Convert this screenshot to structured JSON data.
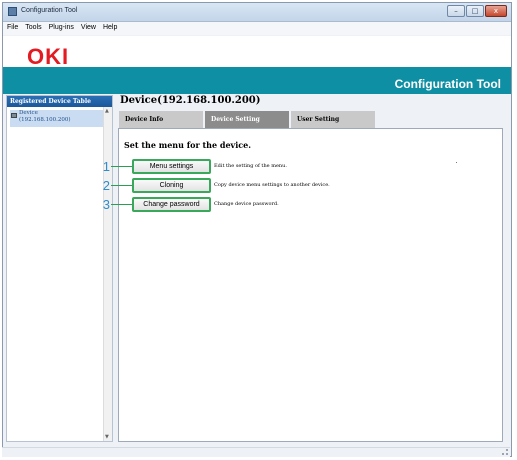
{
  "window": {
    "title": "Configuration Tool",
    "controls": {
      "minimize": "–",
      "maximize": "□",
      "close": "x"
    }
  },
  "menu": [
    "File",
    "Tools",
    "Plug-ins",
    "View",
    "Help"
  ],
  "header": {
    "logo": "OKI",
    "app_title": "Configuration Tool",
    "logo_color": "#e31b23",
    "banner_color": "#0f8fa3"
  },
  "sidebar": {
    "heading": "Registered Device Table",
    "items": [
      {
        "name": "Device",
        "address": "(192.168.100.200)"
      }
    ]
  },
  "main": {
    "device_title": "Device(192.168.100.200)",
    "tabs": [
      {
        "label": "Device Info",
        "active": false
      },
      {
        "label": "Device Setting",
        "active": true
      },
      {
        "label": "User Setting",
        "active": false
      }
    ],
    "panel_title": "Set the menu for the device.",
    "actions": [
      {
        "number": "1",
        "label": "Menu settings",
        "description": "Edit the setting of the menu."
      },
      {
        "number": "2",
        "label": "Cloning",
        "description": "Copy device menu settings to another device."
      },
      {
        "number": "3",
        "label": "Change password",
        "description": "Change device password."
      }
    ],
    "callout_color": "#2e8dcc",
    "highlight_color": "#3aa85a"
  }
}
